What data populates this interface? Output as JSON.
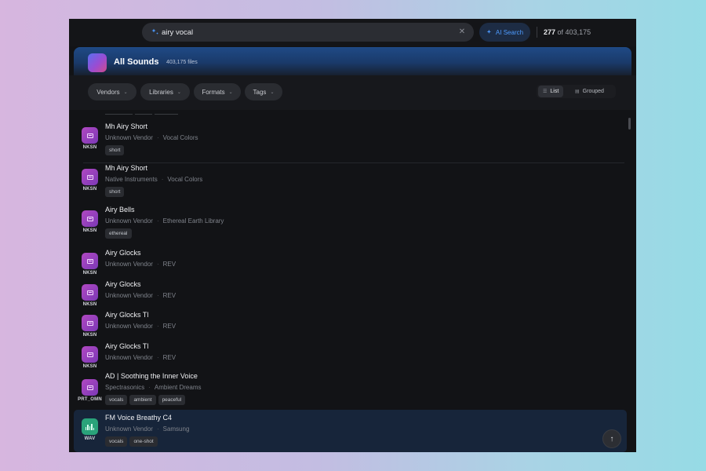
{
  "search": {
    "query": "airy vocal",
    "clear_icon": "close-icon",
    "ai_label": "AI Search",
    "result_count": "277",
    "result_total": "of 403,175"
  },
  "header": {
    "title": "All Sounds",
    "files": "403,175 files"
  },
  "filters": {
    "chips": [
      "Vendors",
      "Libraries",
      "Formats",
      "Tags"
    ],
    "view_list": "List",
    "view_grouped": "Grouped"
  },
  "rows": [
    {
      "title": "Mh Airy Short",
      "vendor": "Unknown Vendor",
      "library": "Vocal Colors",
      "type": "NKSN",
      "tags": [
        "short"
      ]
    },
    {
      "title": "Mh Airy Short",
      "vendor": "Native Instruments",
      "library": "Vocal Colors",
      "type": "NKSN",
      "tags": [
        "short"
      ]
    },
    {
      "title": "Airy Bells",
      "vendor": "Unknown Vendor",
      "library": "Ethereal Earth Library",
      "type": "NKSN",
      "tags": [
        "ethereal"
      ]
    },
    {
      "title": "Airy Glocks",
      "vendor": "Unknown Vendor",
      "library": "REV",
      "type": "NKSN",
      "tags": []
    },
    {
      "title": "Airy Glocks",
      "vendor": "Unknown Vendor",
      "library": "REV",
      "type": "NKSN",
      "tags": []
    },
    {
      "title": "Airy Glocks Tl",
      "vendor": "Unknown Vendor",
      "library": "REV",
      "type": "NKSN",
      "tags": []
    },
    {
      "title": "Airy Glocks Tl",
      "vendor": "Unknown Vendor",
      "library": "REV",
      "type": "NKSN",
      "tags": []
    },
    {
      "title": "AD  |  Soothing the Inner Voice",
      "vendor": "Spectrasonics",
      "library": "Ambient Dreams",
      "type": "PRT_OMN",
      "tags": [
        "vocals",
        "ambient",
        "peaceful"
      ]
    },
    {
      "title": "FM Voice Breathy C4",
      "vendor": "Unknown Vendor",
      "library": "Samsung",
      "type": "WAV",
      "tags": [
        "vocals",
        "one-shot"
      ]
    }
  ],
  "colors": {
    "accent": "#4e9bff",
    "nksn_icon": "#a242c0",
    "wav_icon": "#2aa37a",
    "selected_row": "#17253a"
  }
}
